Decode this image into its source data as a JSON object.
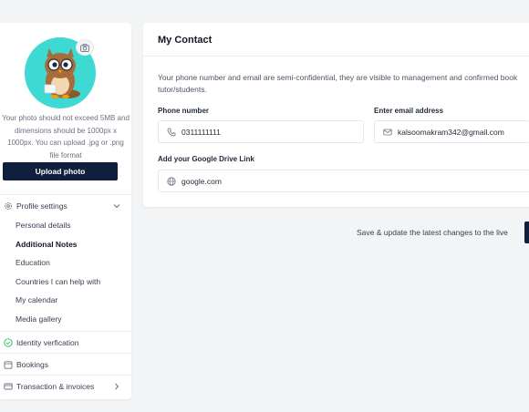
{
  "profile": {
    "photo_note": "Your photo should not exceed 5MB and dimensions should be 1000px x 1000px. You can upload .jpg or .png file format",
    "upload_label": "Upload photo"
  },
  "nav": {
    "profile_settings": "Profile settings",
    "sub_items": [
      "Personal details",
      "Additional Notes",
      "Education",
      "Countries I can help with",
      "My calendar",
      "Media gallery"
    ],
    "identity": "Identity verfication",
    "bookings": "Bookings",
    "transactions": "Transaction & invoices"
  },
  "contact": {
    "title": "My Contact",
    "description_line1": "Your phone number and email are semi-confidential, they are visible to management and confirmed book",
    "description_line2": "tutor/students.",
    "phone_label": "Phone number",
    "phone_value": "0311111111",
    "email_label": "Enter email address",
    "email_value": "kalsoomakram342@gmail.com",
    "drive_label": "Add your Google Drive Link",
    "drive_value": "google.com"
  },
  "footer": {
    "save_text": "Save & update the latest changes to the live"
  },
  "colors": {
    "primary": "#0f1f3d",
    "avatar_bg": "#3fd9d4",
    "identity_check": "#22c55e"
  }
}
